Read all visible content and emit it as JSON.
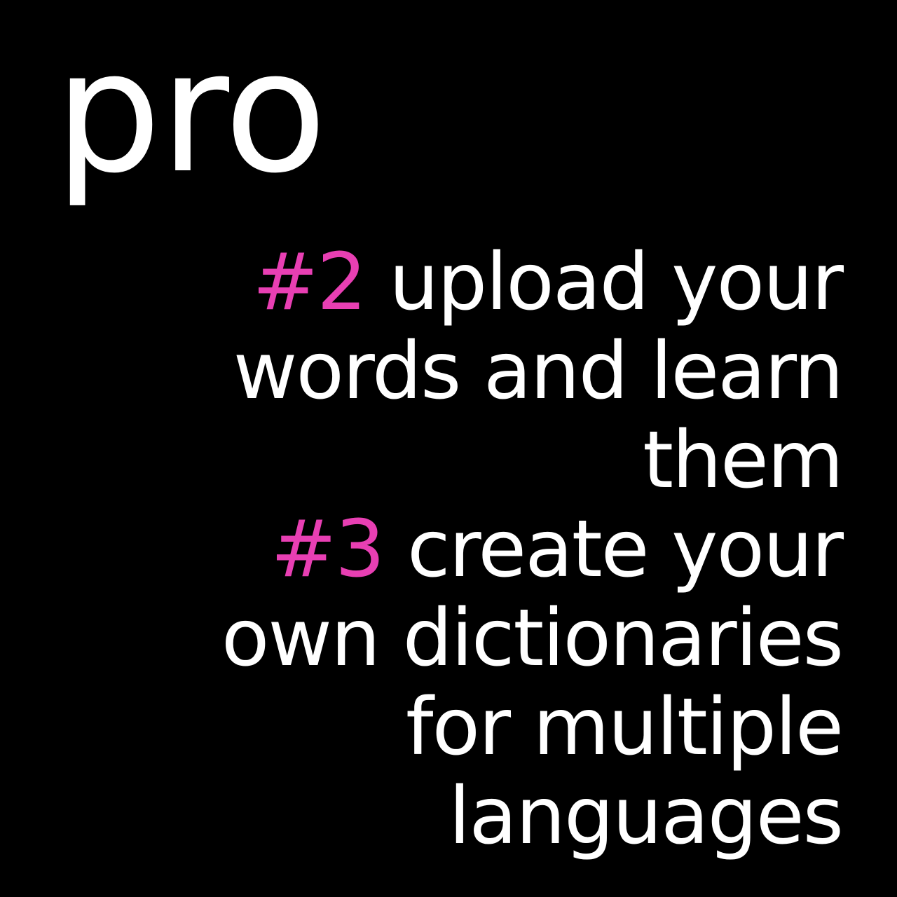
{
  "title": "pro",
  "colors": {
    "background": "#000000",
    "text": "#ffffff",
    "accent": "#e83fb3"
  },
  "features": [
    {
      "number": "#2",
      "lines": [
        "upload your",
        "words and learn",
        "them"
      ]
    },
    {
      "number": "#3",
      "lines": [
        "create your",
        "own dictionaries",
        "for multiple",
        "languages"
      ]
    }
  ]
}
